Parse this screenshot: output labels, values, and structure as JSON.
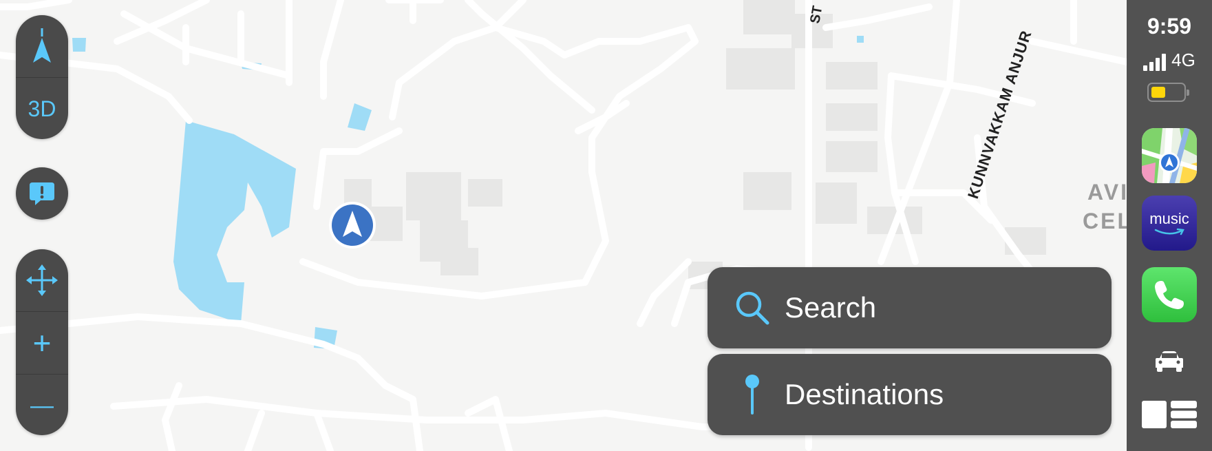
{
  "map": {
    "street_labels": [
      "KUNNVAKKAM ANJUR",
      "ST",
      "AVI",
      "CEL"
    ]
  },
  "controls": {
    "compass_icon": "compass-arrow-icon",
    "mode_3d_label": "3D",
    "report_icon": "report-issue-icon",
    "pan_icon": "pan-arrows-icon",
    "zoom_in_label": "+",
    "zoom_out_label": "—"
  },
  "actions": {
    "search_label": "Search",
    "search_icon": "search-icon",
    "destinations_label": "Destinations",
    "destinations_icon": "pin-icon"
  },
  "status": {
    "time": "9:59",
    "network": "4G",
    "signal_bars": 4,
    "battery_level": 0.45
  },
  "dock": {
    "apps": [
      {
        "name": "Maps",
        "icon": "maps-app-icon"
      },
      {
        "name": "music",
        "icon": "amazon-music-app-icon"
      },
      {
        "name": "Phone",
        "icon": "phone-app-icon"
      }
    ],
    "music_label": "music",
    "car_icon": "car-icon",
    "dashboard_icon": "dashboard-icon"
  },
  "colors": {
    "accent": "#5ac8fa",
    "control_bg": "#4a4a4a",
    "sidebar_bg": "#525252",
    "water": "#9fdcf6",
    "location": "#3b73c4"
  }
}
